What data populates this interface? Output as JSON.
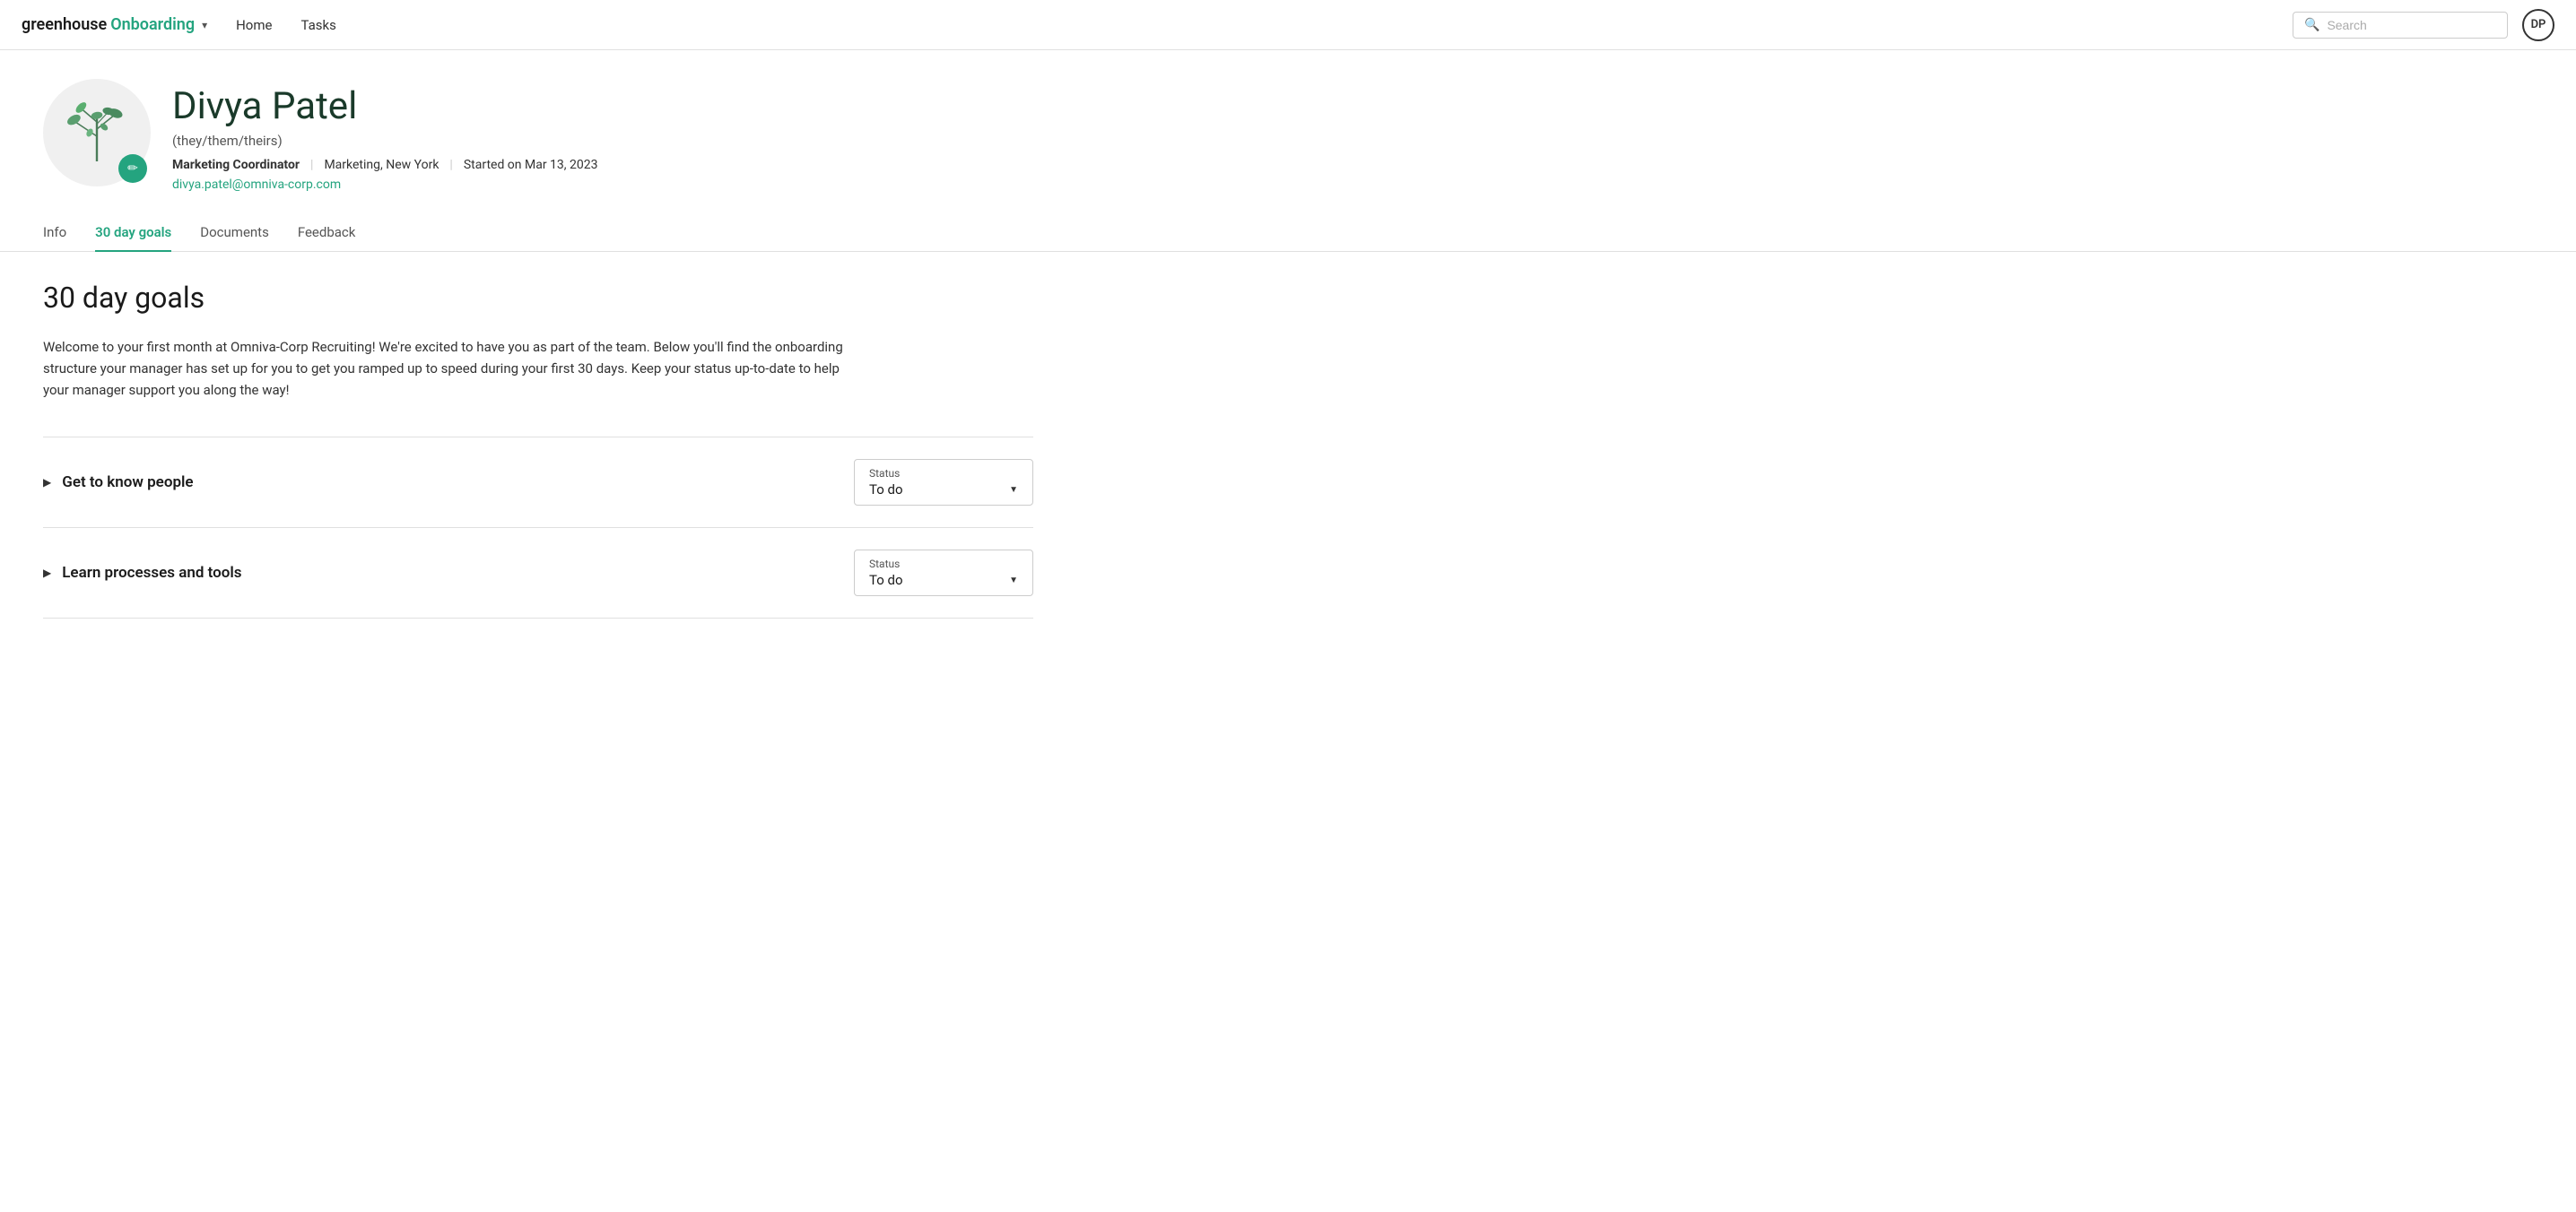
{
  "nav": {
    "brand_greenhouse": "greenhouse",
    "brand_onboarding": "Onboarding",
    "chevron": "▾",
    "links": [
      {
        "label": "Home",
        "id": "home"
      },
      {
        "label": "Tasks",
        "id": "tasks"
      }
    ],
    "search_placeholder": "Search",
    "avatar_initials": "DP"
  },
  "profile": {
    "name": "Divya Patel",
    "pronouns": "(they/them/theirs)",
    "title": "Marketing Coordinator",
    "department": "Marketing, New York",
    "start_date": "Started on Mar 13, 2023",
    "email": "divya.patel@omniva-corp.com",
    "edit_icon": "✏"
  },
  "tabs": [
    {
      "label": "Info",
      "id": "info",
      "active": false
    },
    {
      "label": "30 day goals",
      "id": "30-day-goals",
      "active": true
    },
    {
      "label": "Documents",
      "id": "documents",
      "active": false
    },
    {
      "label": "Feedback",
      "id": "feedback",
      "active": false
    }
  ],
  "section": {
    "title": "30 day goals",
    "description": "Welcome to your first month at Omniva-Corp Recruiting! We're excited to have you as part of the team. Below you'll find the onboarding structure your manager has set up for you to get you ramped up to speed during your first 30 days. Keep your status up-to-date to help your manager support you along the way!"
  },
  "goals": [
    {
      "id": "goal-1",
      "label": "Get to know people",
      "status_label": "Status",
      "status_value": "To do"
    },
    {
      "id": "goal-2",
      "label": "Learn processes and tools",
      "status_label": "Status",
      "status_value": "To do"
    }
  ],
  "colors": {
    "accent": "#24a47f",
    "dark_green": "#1a3a2a"
  }
}
